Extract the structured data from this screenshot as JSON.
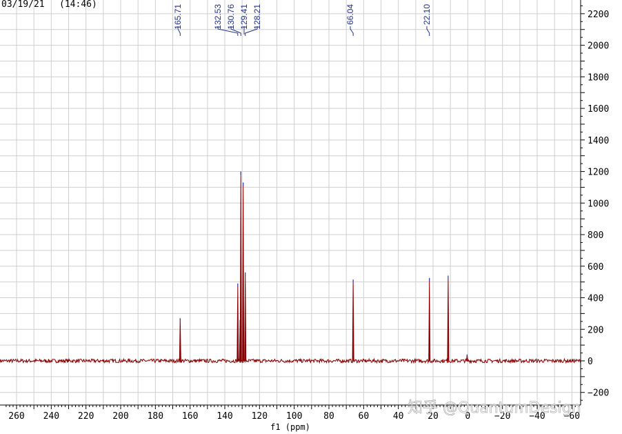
{
  "header": {
    "date": "03/19/21",
    "time": "(14:46)"
  },
  "watermark": "知乎 @QuantumDesign",
  "chart_data": {
    "type": "line",
    "xlabel": "f1 (ppm)",
    "ylabel": "",
    "xlim": [
      267,
      -66
    ],
    "ylim": [
      -250,
      2280
    ],
    "x_reversed": true,
    "grid": true,
    "x_ticks": [
      260,
      240,
      220,
      200,
      180,
      160,
      140,
      120,
      100,
      80,
      60,
      40,
      20,
      0,
      -20,
      -40,
      -60
    ],
    "y_ticks": [
      -200,
      0,
      200,
      400,
      600,
      800,
      1000,
      1200,
      1400,
      1600,
      1800,
      2000,
      2200
    ],
    "baseline": 0,
    "noise_amplitude": 12,
    "peaks": [
      {
        "ppm": 165.71,
        "height": 270
      },
      {
        "ppm": 132.53,
        "height": 490
      },
      {
        "ppm": 131.2,
        "height": 260
      },
      {
        "ppm": 130.76,
        "height": 1200
      },
      {
        "ppm": 129.41,
        "height": 1130
      },
      {
        "ppm": 128.21,
        "height": 560
      },
      {
        "ppm": 66.04,
        "height": 515
      },
      {
        "ppm": 22.1,
        "height": 525
      },
      {
        "ppm": 11.3,
        "height": 540
      },
      {
        "ppm": 0.4,
        "height": 40
      }
    ],
    "peak_labels": [
      "165.71",
      "132.53",
      "130.76",
      "129.41",
      "128.21",
      "66.04",
      "22.10"
    ],
    "line_color": "#8b0000",
    "peak_tip_color": "#3344cc"
  }
}
